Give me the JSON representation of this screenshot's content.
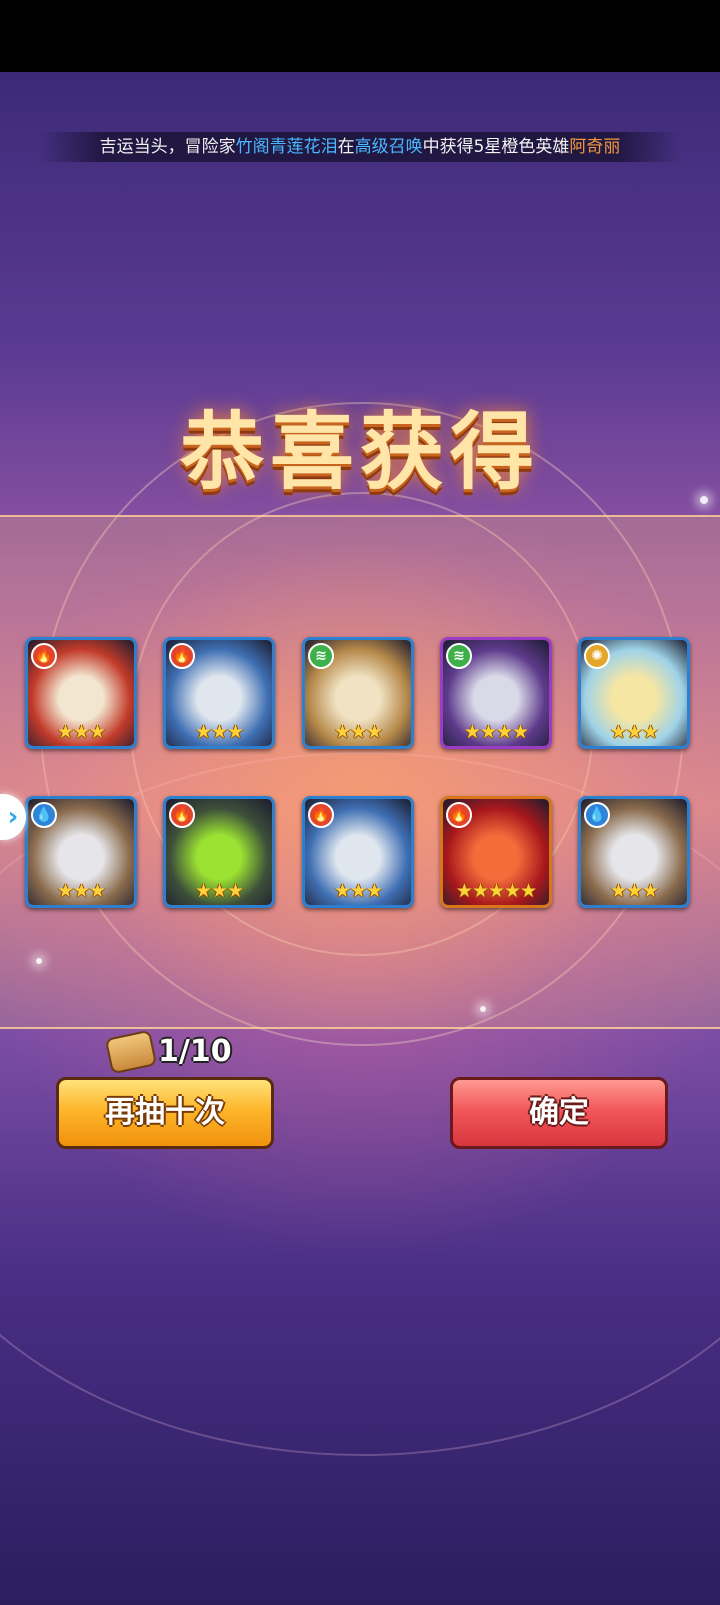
{
  "announcement": {
    "prefix": "吉运当头，冒险家",
    "player": "竹阁青莲花泪",
    "mid1": "在",
    "pool": "高级召唤",
    "mid2": "中获得5星橙色英雄",
    "hero": "阿奇丽"
  },
  "title": "恭喜获得",
  "heroes": [
    {
      "element": "fire",
      "stars": 3,
      "rarity": "blue",
      "portrait": "dwarf-warrior",
      "colors": [
        "#c23b2a",
        "#f3e6d0"
      ]
    },
    {
      "element": "fire",
      "stars": 3,
      "rarity": "blue",
      "portrait": "white-werewolf",
      "colors": [
        "#3f6fb3",
        "#dfe6ee"
      ]
    },
    {
      "element": "wind",
      "stars": 3,
      "rarity": "blue",
      "portrait": "eagle-warrior",
      "colors": [
        "#b6894a",
        "#f0e2c2"
      ]
    },
    {
      "element": "wind",
      "stars": 4,
      "rarity": "purple",
      "portrait": "old-sage",
      "colors": [
        "#5e3b8c",
        "#d9d9e8"
      ]
    },
    {
      "element": "light",
      "stars": 3,
      "rarity": "blue",
      "portrait": "blonde-elf",
      "colors": [
        "#9fd3e8",
        "#f5e6a3"
      ]
    },
    {
      "element": "water",
      "stars": 3,
      "rarity": "blue",
      "portrait": "silver-elf",
      "colors": [
        "#8a6b4d",
        "#e6e6ea"
      ]
    },
    {
      "element": "fire",
      "stars": 3,
      "rarity": "blue",
      "portrait": "stone-golem",
      "colors": [
        "#3d4f3a",
        "#9be232"
      ]
    },
    {
      "element": "fire",
      "stars": 3,
      "rarity": "blue",
      "portrait": "white-werewolf",
      "colors": [
        "#3f6fb3",
        "#dfe6ee"
      ]
    },
    {
      "element": "fire",
      "stars": 5,
      "rarity": "orange",
      "portrait": "red-haired-heroine",
      "colors": [
        "#a8181c",
        "#f36c3a"
      ]
    },
    {
      "element": "water",
      "stars": 3,
      "rarity": "blue",
      "portrait": "silver-elf",
      "colors": [
        "#8a6b4d",
        "#e6e6ea"
      ]
    }
  ],
  "counter": "1/10",
  "buttons": {
    "again": "再抽十次",
    "confirm": "确定"
  }
}
